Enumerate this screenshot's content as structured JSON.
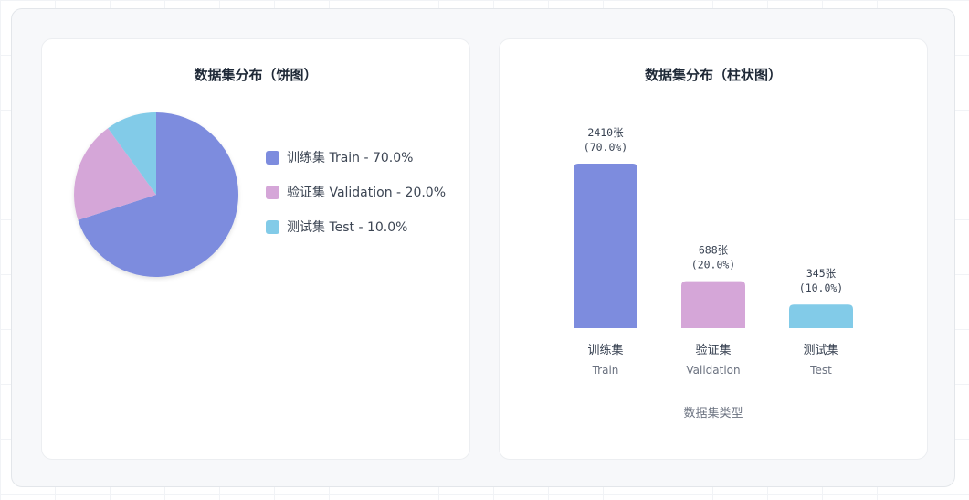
{
  "colors": {
    "train": "#7d8cde",
    "validation": "#d5a6d8",
    "test": "#82cbe8"
  },
  "pie_card": {
    "title": "数据集分布（饼图）",
    "legend": [
      {
        "label": "训练集 Train - 70.0%",
        "color": "#7d8cde"
      },
      {
        "label": "验证集 Validation - 20.0%",
        "color": "#d5a6d8"
      },
      {
        "label": "测试集 Test - 10.0%",
        "color": "#82cbe8"
      }
    ]
  },
  "bar_card": {
    "title": "数据集分布（柱状图）"
  },
  "chart_data": [
    {
      "type": "pie",
      "title": "数据集分布（饼图）",
      "categories": [
        "训练集 Train",
        "验证集 Validation",
        "测试集 Test"
      ],
      "values": [
        70.0,
        20.0,
        10.0
      ],
      "colors": [
        "#7d8cde",
        "#d5a6d8",
        "#82cbe8"
      ],
      "legend": "right"
    },
    {
      "type": "bar",
      "title": "数据集分布（柱状图）",
      "xlabel": "数据集类型",
      "ylabel": "",
      "categories": [
        "训练集",
        "验证集",
        "测试集"
      ],
      "category_sublabels": [
        "Train",
        "Validation",
        "Test"
      ],
      "values": [
        2410,
        688,
        345
      ],
      "value_labels": [
        "2410张",
        "688张",
        "345张"
      ],
      "percent_labels": [
        "(70.0%)",
        "(20.0%)",
        "(10.0%)"
      ],
      "colors": [
        "#7d8cde",
        "#d5a6d8",
        "#82cbe8"
      ],
      "grid": false
    }
  ]
}
